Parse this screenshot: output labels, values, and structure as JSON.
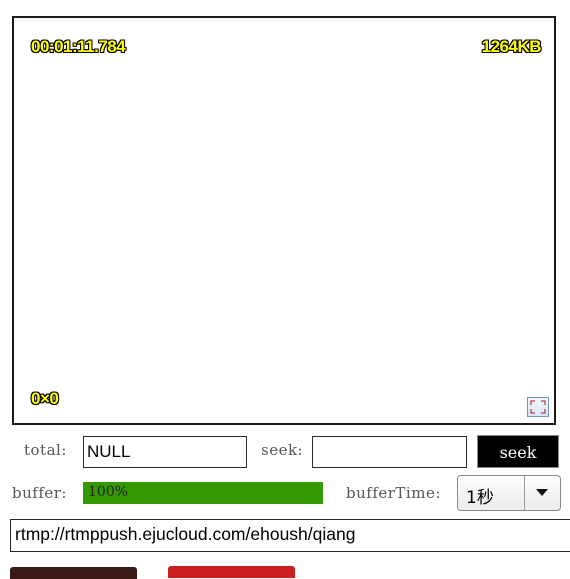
{
  "player": {
    "timestamp": "00:01:11.784",
    "bytes": "1264KB",
    "resolution": "0×0",
    "fullscreen_icon": "fullscreen-icon"
  },
  "controls": {
    "total_label": "total:",
    "total_value": "NULL",
    "seek_label": "seek:",
    "seek_value": "",
    "seek_button": "seek",
    "buffer_label": "buffer:",
    "buffer_percent": 100,
    "buffer_text": "100%",
    "buffer_time_label": "bufferTime:",
    "buffer_time_value": "1秒"
  },
  "stream": {
    "url": "rtmp://rtmppush.ejucloud.com/ehoush/qiang"
  },
  "colors": {
    "osd_text": "#ffff00",
    "buffer_fill": "#339900",
    "seek_button_bg": "#000000",
    "button_a": "#3a1a14",
    "button_b": "#cc1f1f"
  }
}
